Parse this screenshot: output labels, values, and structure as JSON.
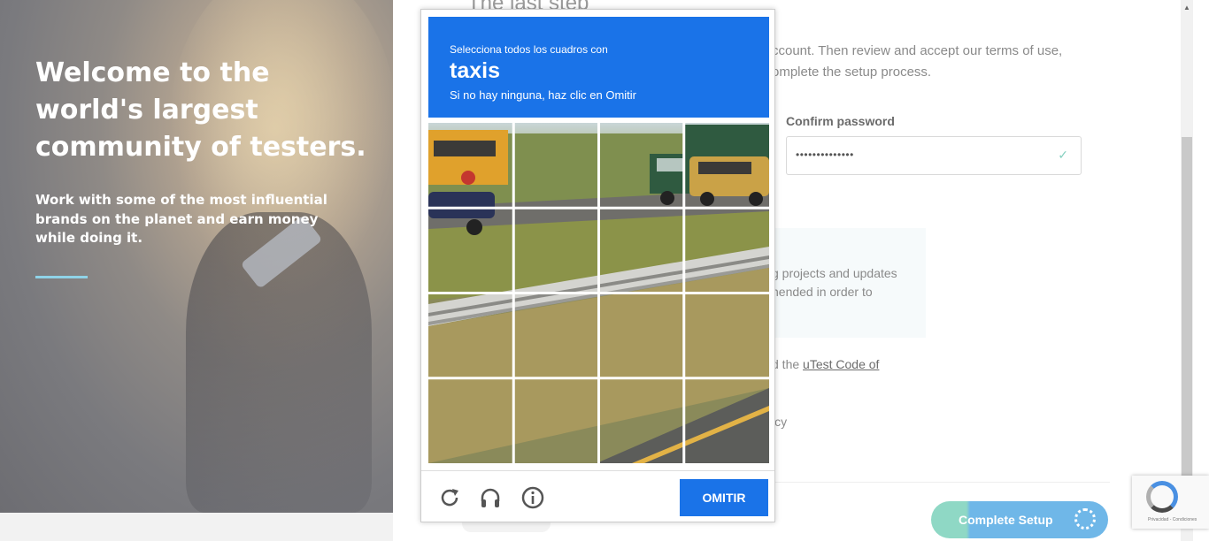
{
  "hero": {
    "heading": "Welcome to the world's largest community of testers.",
    "subtext": "Work with some of the most influential brands on the planet and earn money while doing it."
  },
  "form": {
    "title": "The last step",
    "intro": "ccount. Then review and accept our terms of use, omplete the setup process.",
    "confirm_password_label": "Confirm password",
    "confirm_password_value": "••••••••••••••",
    "info_text": "g projects and updates nended in order to",
    "code_text_prefix": "d the ",
    "code_link": "uTest Code of",
    "policy_text": "icy",
    "complete_setup_label": "Complete Setup"
  },
  "captcha": {
    "lead": "Selecciona todos los cuadros con",
    "object": "taxis",
    "hint": "Si no hay ninguna, haz clic en Omitir",
    "skip_label": "OMITIR",
    "colors": {
      "header": "#1a73e8",
      "button": "#1a73e8"
    }
  },
  "recaptcha_badge": {
    "fine_print": "Privacidad - Condiciones"
  },
  "icons": {
    "reload": "reload-icon",
    "audio": "headphones-icon",
    "info": "info-icon",
    "check": "check-icon"
  }
}
